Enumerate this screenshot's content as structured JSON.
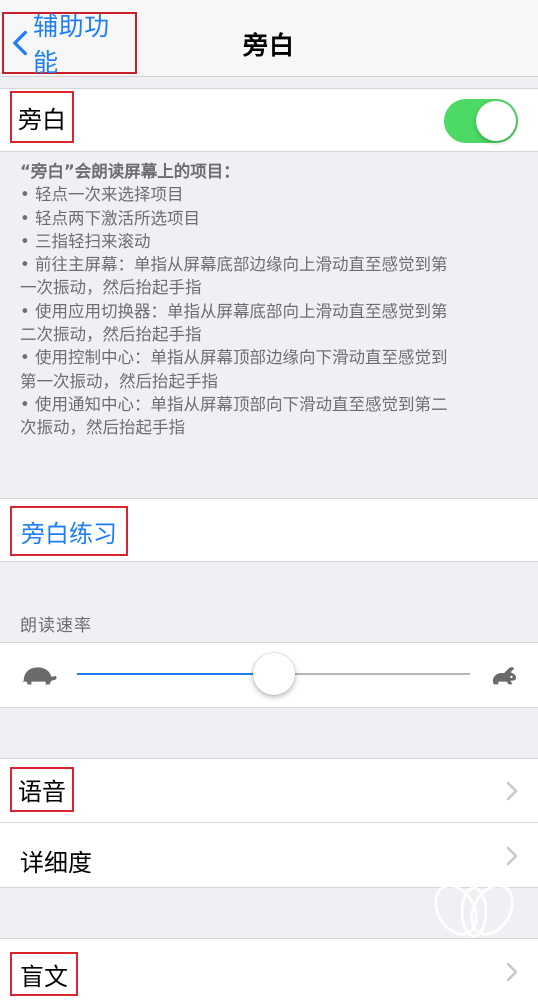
{
  "nav": {
    "back_label": "辅助功能",
    "title": "旁白"
  },
  "voiceover_row": {
    "label": "旁白",
    "toggle_on": true,
    "toggle_color": "#4cd964"
  },
  "description": {
    "heading": "“旁白”会朗读屏幕上的项目：",
    "lines": [
      "•  轻点一次来选择项目",
      "•  轻点两下激活所选项目",
      "•  三指轻扫来滚动",
      "•  前往主屏幕：单指从屏幕底部边缘向上滑动直至感觉到第",
      "一次振动，然后抬起手指",
      "•  使用应用切换器：单指从屏幕底部向上滑动直至感觉到第",
      "二次振动，然后抬起手指",
      "•  使用控制中心：单指从屏幕顶部边缘向下滑动直至感觉到",
      "第一次振动，然后抬起手指",
      "•  使用通知中心：单指从屏幕顶部向下滑动直至感觉到第二",
      "次振动，然后抬起手指"
    ]
  },
  "practice": {
    "label": "旁白练习"
  },
  "speaking_rate": {
    "header": "朗读速率",
    "value_fraction": 0.5,
    "min_icon": "turtle-icon",
    "max_icon": "rabbit-icon"
  },
  "rows": {
    "speech": "语音",
    "verbosity": "详细度",
    "braille": "盲文"
  },
  "colors": {
    "accent": "#1e7ef5",
    "highlight_box": "#d8262f"
  }
}
